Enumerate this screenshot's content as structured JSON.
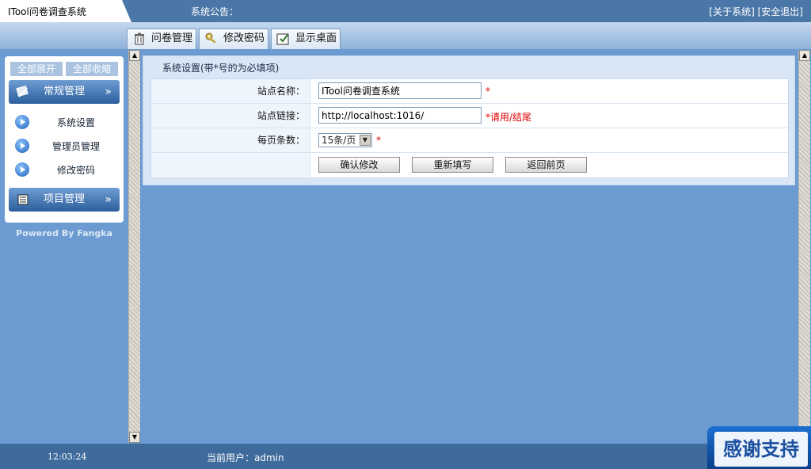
{
  "header": {
    "app_title": "ITool问卷调查系统",
    "notice_label": "系统公告：",
    "about_link": "[关于系统]",
    "logout_link": "[安全退出]"
  },
  "tabs": [
    {
      "label": "问卷管理",
      "icon": "trash-icon"
    },
    {
      "label": "修改密码",
      "icon": "keys-icon"
    },
    {
      "label": "显示桌面",
      "icon": "desktop-icon"
    }
  ],
  "sidebar": {
    "expand_all": "全部展开",
    "collapse_all": "全部收缩",
    "groups": [
      {
        "label": "常规管理",
        "items": [
          "系统设置",
          "管理员管理",
          "修改密码"
        ]
      },
      {
        "label": "项目管理",
        "items": []
      }
    ],
    "powered_by": "Powered By Fangka"
  },
  "form": {
    "caption": "系统设置(带*号的为必填项)",
    "site_name_label": "站点名称：",
    "site_name_value": "ITool问卷调查系统",
    "site_name_required": "*",
    "site_link_label": "站点链接：",
    "site_link_value": "http://localhost:1016/",
    "site_link_hint": "*请用/结尾",
    "per_page_label": "每页条数：",
    "per_page_value": "15条/页",
    "per_page_required": "*",
    "confirm_button": "确认修改",
    "reset_button": "重新填写",
    "back_button": "返回前页"
  },
  "footer": {
    "clock": "12:03:24",
    "current_user": "当前用户：admin",
    "thanks_badge": "感谢支持"
  },
  "colors": {
    "background": "#6b9bd1",
    "topbar": "#4a77a8",
    "required": "#dd0000"
  }
}
